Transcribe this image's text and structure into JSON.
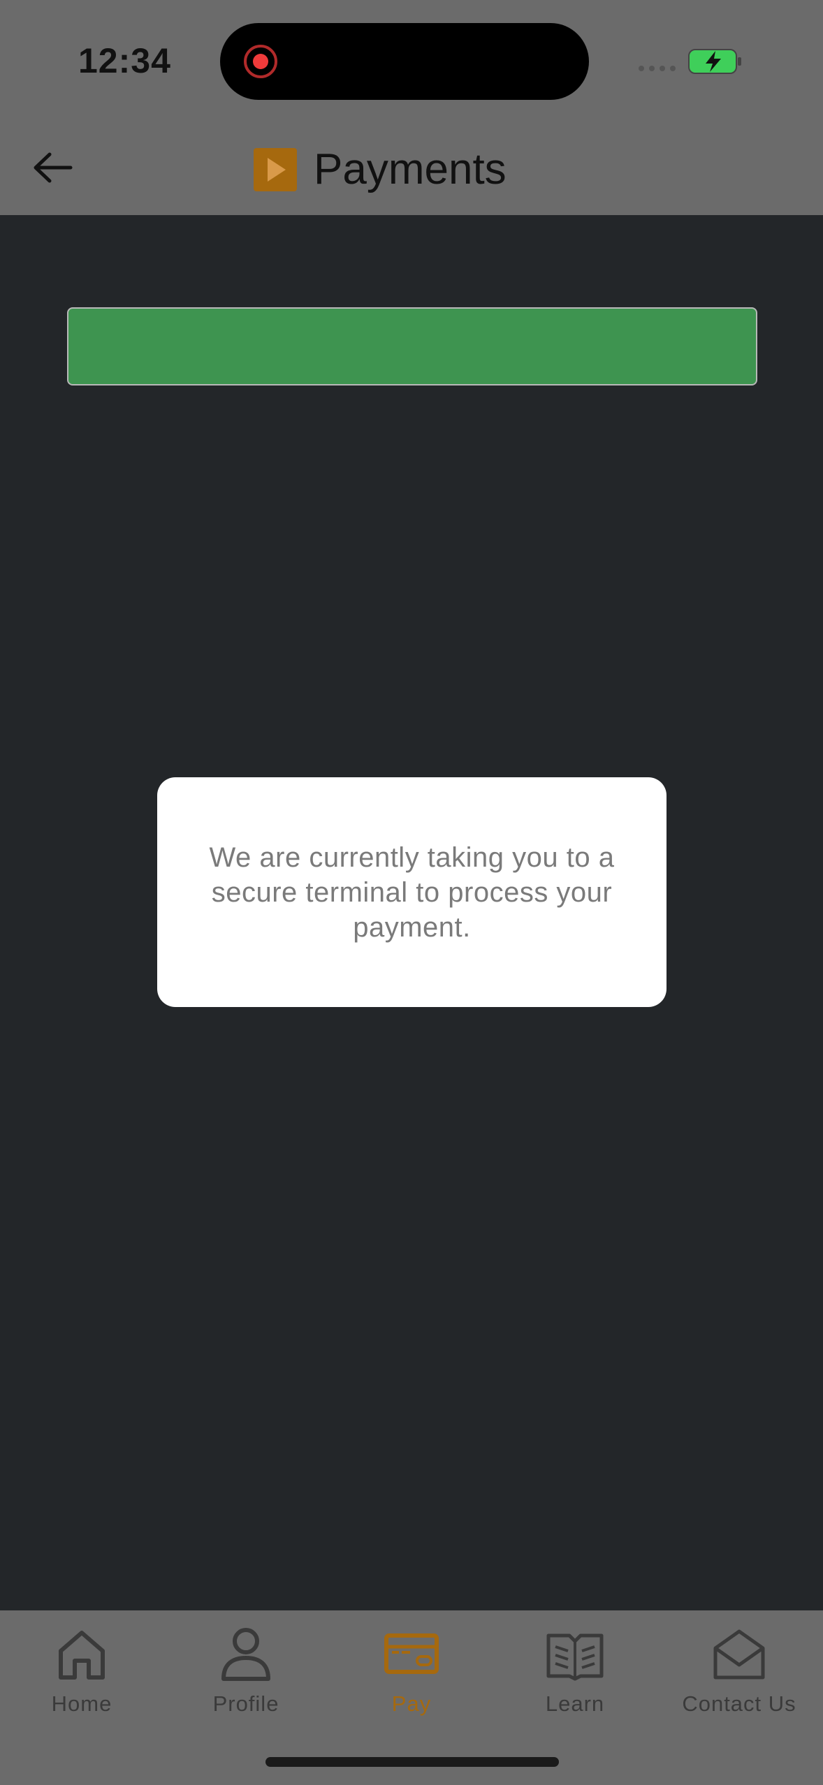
{
  "status_bar": {
    "time": "12:34"
  },
  "header": {
    "title": "Payments",
    "back_icon": "arrow-left-icon",
    "logo_icon": "play-logo-icon"
  },
  "dialog": {
    "message": "We are currently taking you to a secure terminal to process your payment."
  },
  "tabs": [
    {
      "label": "Home",
      "icon": "home-icon",
      "active": false
    },
    {
      "label": "Profile",
      "icon": "person-icon",
      "active": false
    },
    {
      "label": "Pay",
      "icon": "credit-card-icon",
      "active": true
    },
    {
      "label": "Learn",
      "icon": "book-icon",
      "active": false
    },
    {
      "label": "Contact Us",
      "icon": "mail-icon",
      "active": false
    }
  ],
  "colors": {
    "accent": "#a6690e",
    "progress_green": "#3e9450",
    "background": "#232629",
    "header_overlay": "#6b6b6b"
  }
}
